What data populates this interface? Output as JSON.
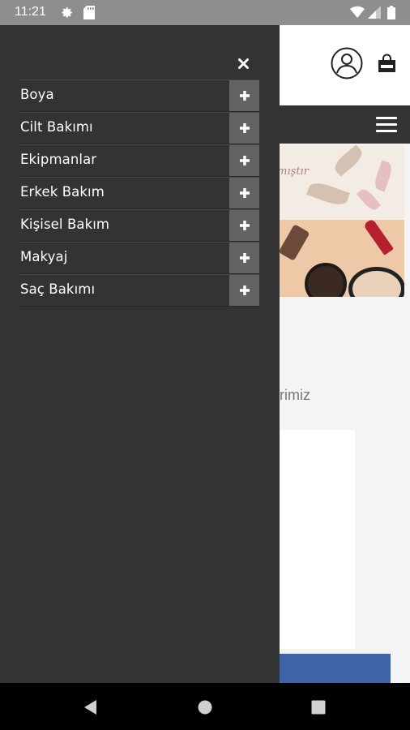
{
  "status_bar": {
    "time": "11:21",
    "icons": [
      "gear-icon",
      "sd-card-icon",
      "wifi-icon",
      "signal-icon",
      "battery-icon"
    ]
  },
  "page": {
    "banner_script_text": "lmıştır",
    "section_text": "rimiz"
  },
  "drawer": {
    "close_icon": "close-icon",
    "menu_items": [
      {
        "label": "Boya",
        "icon": "plus-icon"
      },
      {
        "label": "Cilt Bakımı",
        "icon": "plus-icon"
      },
      {
        "label": "Ekipmanlar",
        "icon": "plus-icon"
      },
      {
        "label": "Erkek Bakım",
        "icon": "plus-icon"
      },
      {
        "label": "Kişisel Bakım",
        "icon": "plus-icon"
      },
      {
        "label": "Makyaj",
        "icon": "plus-icon"
      },
      {
        "label": "Saç Bakımı",
        "icon": "plus-icon"
      }
    ]
  },
  "colors": {
    "drawer_bg": "#333333",
    "plus_button_bg": "#636363",
    "nav_bar_bg": "#333333",
    "accent_blue": "#3f63a8"
  },
  "system_nav": [
    "back-icon",
    "home-icon",
    "recent-apps-icon"
  ]
}
